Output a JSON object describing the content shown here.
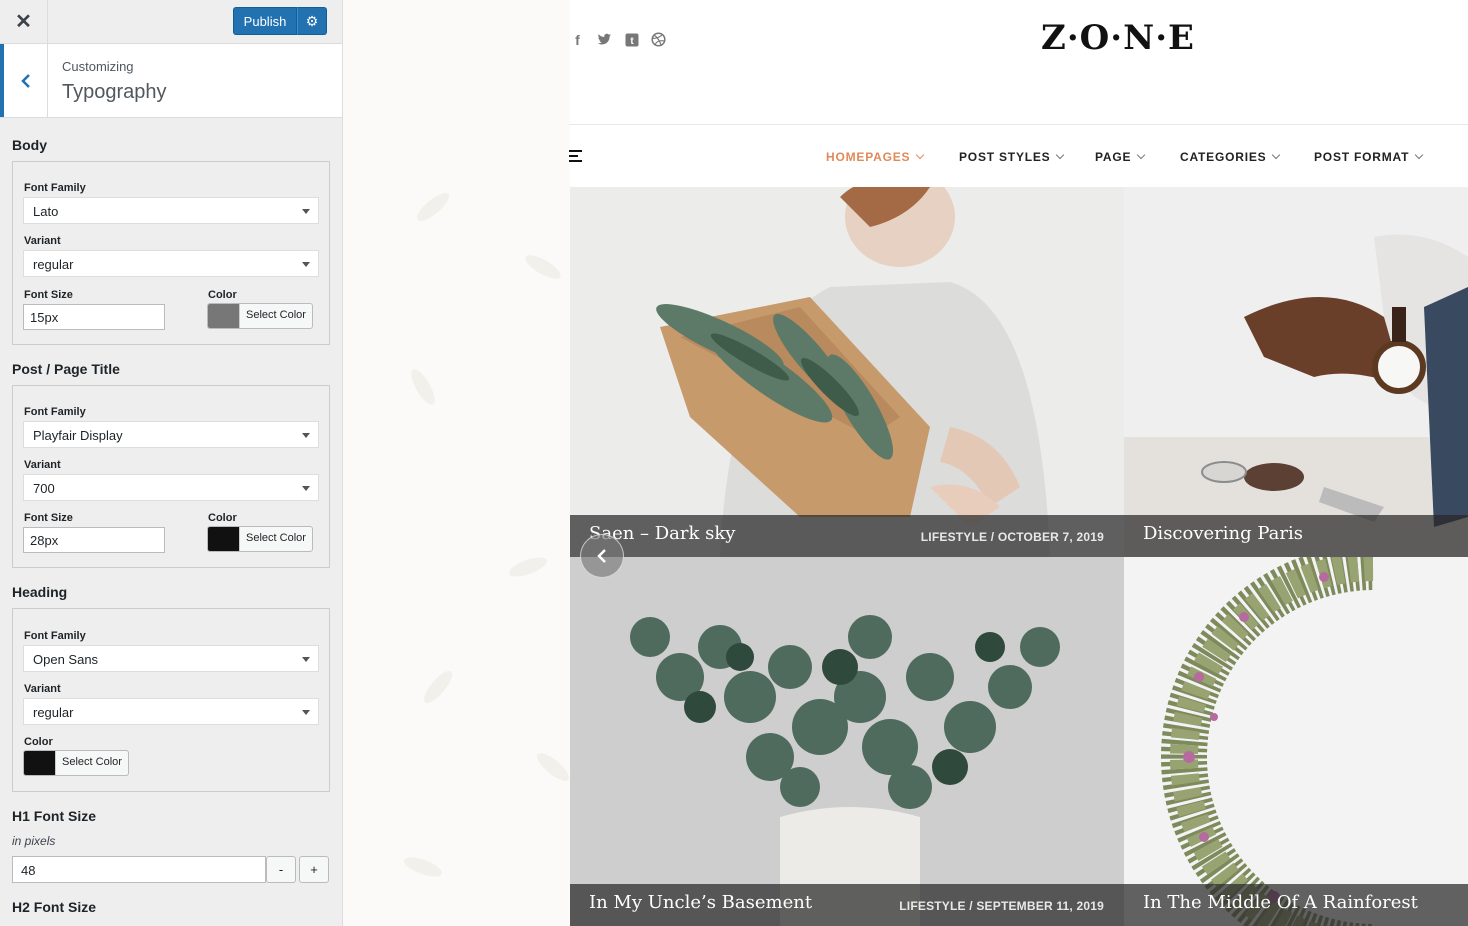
{
  "customizer": {
    "close_label": "✕",
    "publish_label": "Publish",
    "gear_icon": "⚙",
    "customizing_label": "Customizing",
    "section_title": "Typography",
    "body": {
      "title": "Body",
      "font_family_label": "Font Family",
      "font_family": "Lato",
      "variant_label": "Variant",
      "variant": "regular",
      "font_size_label": "Font Size",
      "font_size": "15px",
      "color_label": "Color",
      "color_button": "Select Color",
      "color": "#777777"
    },
    "post_title": {
      "title": "Post / Page Title",
      "font_family_label": "Font Family",
      "font_family": "Playfair Display",
      "variant_label": "Variant",
      "variant": "700",
      "font_size_label": "Font Size",
      "font_size": "28px",
      "color_label": "Color",
      "color_button": "Select Color",
      "color": "#111111"
    },
    "heading": {
      "title": "Heading",
      "font_family_label": "Font Family",
      "font_family": "Open Sans",
      "variant_label": "Variant",
      "variant": "regular",
      "color_label": "Color",
      "color_button": "Select Color",
      "color": "#111111"
    },
    "h1": {
      "title": "H1 Font Size",
      "subtitle": "in pixels",
      "value": "48",
      "minus": "-",
      "plus": "+"
    },
    "h2": {
      "title": "H2 Font Size"
    }
  },
  "site": {
    "logo": "Z·O·N·E",
    "social": [
      "f",
      "t",
      "t",
      "⊛"
    ],
    "nav": [
      {
        "label": "HOMEPAGES",
        "active": true
      },
      {
        "label": "POST STYLES",
        "active": false
      },
      {
        "label": "PAGE",
        "active": false
      },
      {
        "label": "CATEGORIES",
        "active": false
      },
      {
        "label": "POST FORMAT",
        "active": false
      }
    ],
    "accent_color": "#e08a5a",
    "posts": [
      {
        "title": "Saen – Dark sky",
        "meta": "LIFESTYLE / OCTOBER 7, 2019"
      },
      {
        "title": "Discovering Paris",
        "meta": ""
      },
      {
        "title": "In My Uncle’s Basement",
        "meta": "LIFESTYLE / SEPTEMBER 11, 2019"
      },
      {
        "title": "In The Middle Of A Rainforest",
        "meta": ""
      }
    ],
    "slider_prev": "‹"
  }
}
